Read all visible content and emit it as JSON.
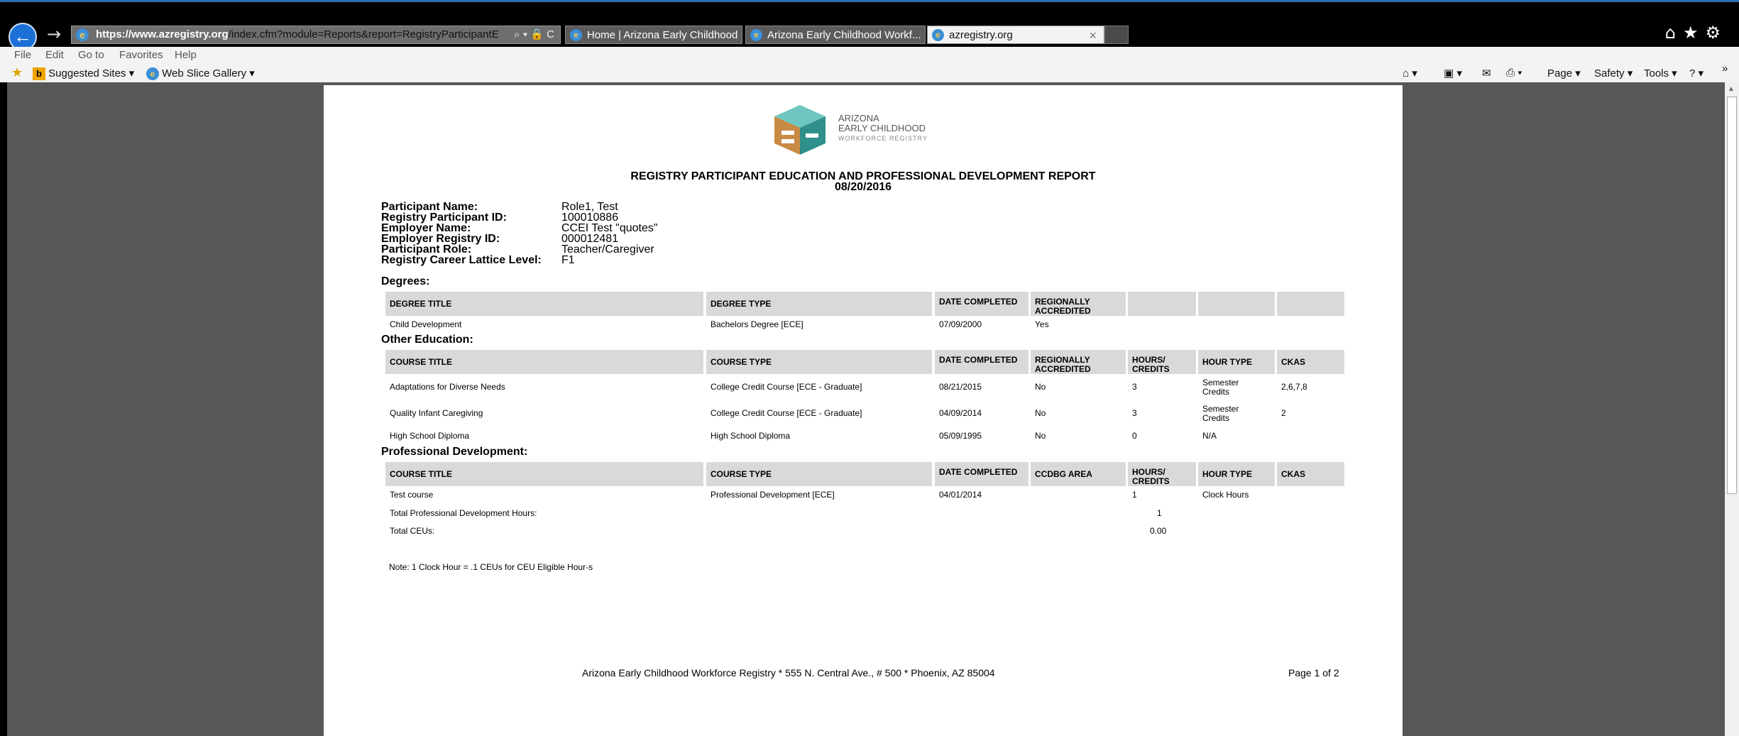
{
  "browser": {
    "url_host": "https://www.azregistry.org",
    "url_path": "/index.cfm?module=Reports&report=RegistryParticipantE",
    "url_tools": "⌕ ▾ 🔒 C",
    "tabs": [
      {
        "label": "Home | Arizona Early Childhood",
        "active": false
      },
      {
        "label": "Arizona Early Childhood Workf...",
        "active": false
      },
      {
        "label": "azregistry.org",
        "active": true
      }
    ],
    "menu": [
      "File",
      "Edit",
      "Go to",
      "Favorites",
      "Help"
    ],
    "favorites": {
      "suggested": "Suggested Sites ▾",
      "webslice": "Web Slice Gallery ▾"
    },
    "commands": {
      "page": "Page ▾",
      "safety": "Safety ▾",
      "tools": "Tools ▾"
    }
  },
  "report": {
    "logo_line1": "ARIZONA",
    "logo_line2": "EARLY CHILDHOOD",
    "logo_line3": "WORKFORCE REGISTRY",
    "title": "REGISTRY PARTICIPANT EDUCATION AND PROFESSIONAL DEVELOPMENT REPORT",
    "date": "08/20/2016",
    "info": [
      {
        "label": "Participant Name:",
        "value": "Role1, Test"
      },
      {
        "label": "Registry Participant ID:",
        "value": "100010886"
      },
      {
        "label": "Employer Name:",
        "value": "CCEI Test \"quotes\""
      },
      {
        "label": "Employer Registry ID:",
        "value": "000012481"
      },
      {
        "label": "Participant Role:",
        "value": "Teacher/Caregiver"
      },
      {
        "label": "Registry Career Lattice Level:",
        "value": "F1"
      }
    ],
    "degrees": {
      "heading": "Degrees:",
      "headers": [
        "DEGREE TITLE",
        "DEGREE TYPE",
        "DATE COMPLETED",
        "REGIONALLY ACCREDITED",
        "",
        "",
        ""
      ],
      "rows": [
        [
          "Child Development",
          "Bachelors Degree [ECE]",
          "07/09/2000",
          "Yes"
        ]
      ]
    },
    "other": {
      "heading": "Other Education:",
      "headers": [
        "COURSE TITLE",
        "COURSE TYPE",
        "DATE COMPLETED",
        "REGIONALLY ACCREDITED",
        "HOURS/ CREDITS",
        "HOUR TYPE",
        "CKAS"
      ],
      "rows": [
        [
          "Adaptations for Diverse Needs",
          "College Credit Course [ECE - Graduate]",
          "08/21/2015",
          "No",
          "3",
          "Semester Credits",
          "2,6,7,8"
        ],
        [
          "Quality Infant Caregiving",
          "College Credit Course [ECE - Graduate]",
          "04/09/2014",
          "No",
          "3",
          "Semester Credits",
          "2"
        ],
        [
          "High School Diploma",
          "High School Diploma",
          "05/09/1995",
          "No",
          "0",
          "N/A",
          ""
        ]
      ]
    },
    "pd": {
      "heading": "Professional Development:",
      "headers": [
        "COURSE TITLE",
        "COURSE TYPE",
        "DATE COMPLETED",
        "CCDBG AREA",
        "HOURS/ CREDITS",
        "HOUR TYPE",
        "CKAS"
      ],
      "rows": [
        [
          "Test course",
          "Professional Development [ECE]",
          "04/01/2014",
          "",
          "1",
          "Clock Hours",
          ""
        ]
      ],
      "total_hours_label": "Total Professional Development Hours:",
      "total_hours": "1",
      "total_ceus_label": "Total CEUs:",
      "total_ceus": "0.00"
    },
    "note": "Note: 1 Clock Hour = .1 CEUs for CEU Eligible Hour-s",
    "footer": "Arizona Early Childhood Workforce Registry * 555 N. Central Ave., # 500 * Phoenix, AZ 85004",
    "page_num": "Page 1 of 2"
  }
}
